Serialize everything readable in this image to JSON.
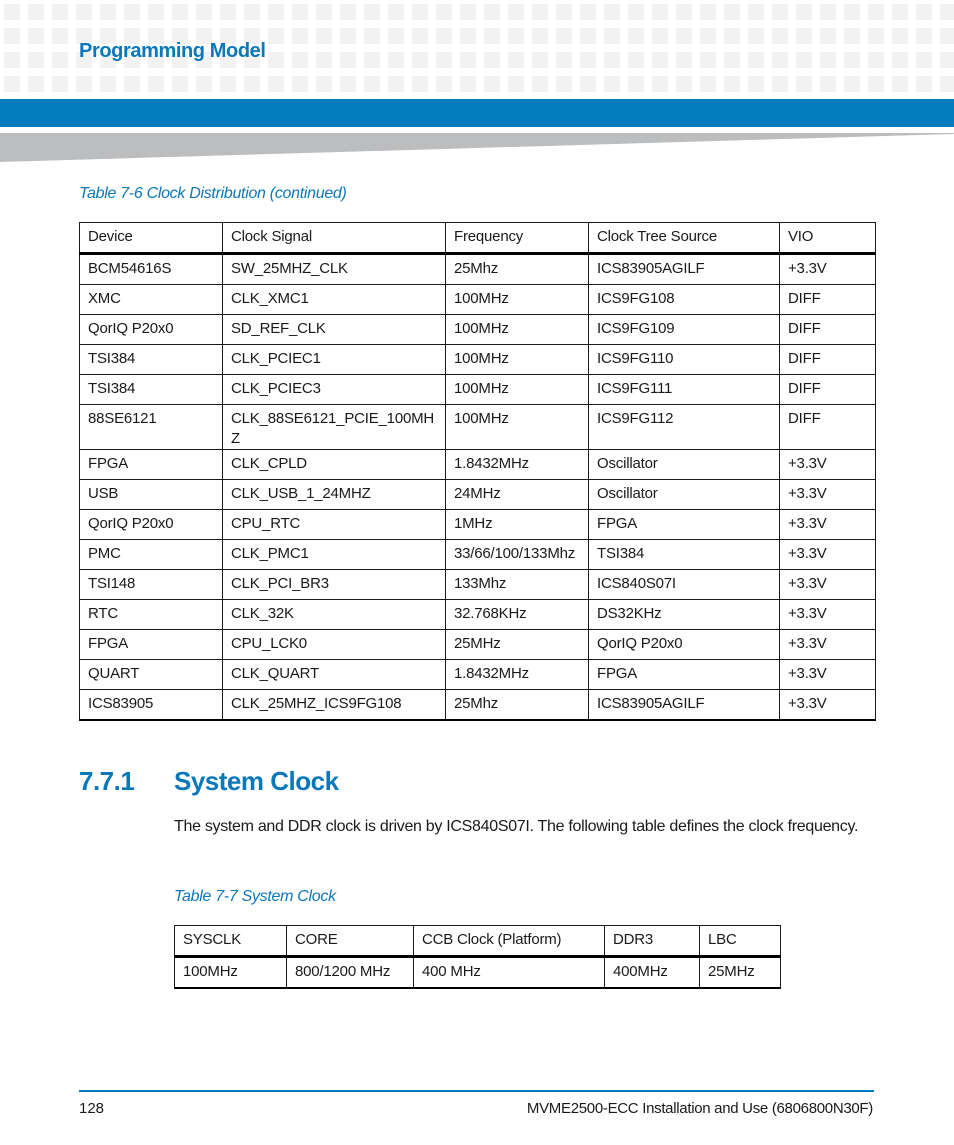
{
  "header": {
    "section_title": "Programming Model",
    "accent_color": "#027cbd"
  },
  "table_7_6": {
    "caption": "Table 7-6 Clock Distribution  (continued)",
    "columns": [
      "Device",
      "Clock Signal",
      "Frequency",
      "Clock Tree Source",
      "VIO"
    ],
    "rows": [
      [
        "BCM54616S",
        "SW_25MHZ_CLK",
        "25Mhz",
        "ICS83905AGILF",
        "+3.3V"
      ],
      [
        "XMC",
        "CLK_XMC1",
        "100MHz",
        "ICS9FG108",
        "DIFF"
      ],
      [
        "QorIQ P20x0",
        "SD_REF_CLK",
        "100MHz",
        "ICS9FG109",
        "DIFF"
      ],
      [
        "TSI384",
        "CLK_PCIEC1",
        "100MHz",
        "ICS9FG110",
        "DIFF"
      ],
      [
        "TSI384",
        "CLK_PCIEC3",
        "100MHz",
        "ICS9FG111",
        "DIFF"
      ],
      [
        "88SE6121",
        "CLK_88SE6121_PCIE_100MHZ",
        "100MHz",
        "ICS9FG112",
        "DIFF"
      ],
      [
        "FPGA",
        "CLK_CPLD",
        "1.8432MHz",
        "Oscillator",
        "+3.3V"
      ],
      [
        "USB",
        "CLK_USB_1_24MHZ",
        "24MHz",
        "Oscillator",
        "+3.3V"
      ],
      [
        "QorIQ P20x0",
        "CPU_RTC",
        "1MHz",
        "FPGA",
        "+3.3V"
      ],
      [
        "PMC",
        "CLK_PMC1",
        "33/66/100/133Mhz",
        "TSI384",
        "+3.3V"
      ],
      [
        "TSI148",
        "CLK_PCI_BR3",
        "133Mhz",
        "ICS840S07I",
        "+3.3V"
      ],
      [
        "RTC",
        "CLK_32K",
        "32.768KHz",
        "DS32KHz",
        "+3.3V"
      ],
      [
        "FPGA",
        "CPU_LCK0",
        "25MHz",
        "QorIQ P20x0",
        "+3.3V"
      ],
      [
        "QUART",
        "CLK_QUART",
        "1.8432MHz",
        "FPGA",
        "+3.3V"
      ],
      [
        "ICS83905",
        "CLK_25MHZ_ICS9FG108",
        "25Mhz",
        "ICS83905AGILF",
        "+3.3V"
      ]
    ]
  },
  "section_7_7_1": {
    "number": "7.7.1",
    "title": "System Clock",
    "paragraph": "The system and DDR clock is driven by ICS840S07I. The following table defines the clock frequency."
  },
  "table_7_7": {
    "caption": "Table 7-7 System Clock",
    "columns": [
      "SYSCLK",
      "CORE",
      "CCB Clock (Platform)",
      "DDR3",
      "LBC"
    ],
    "rows": [
      [
        "100MHz",
        "800/1200 MHz",
        "400 MHz",
        "400MHz",
        "25MHz"
      ]
    ]
  },
  "footer": {
    "page_number": "128",
    "document_title": "MVME2500-ECC Installation and Use (6806800N30F)"
  }
}
